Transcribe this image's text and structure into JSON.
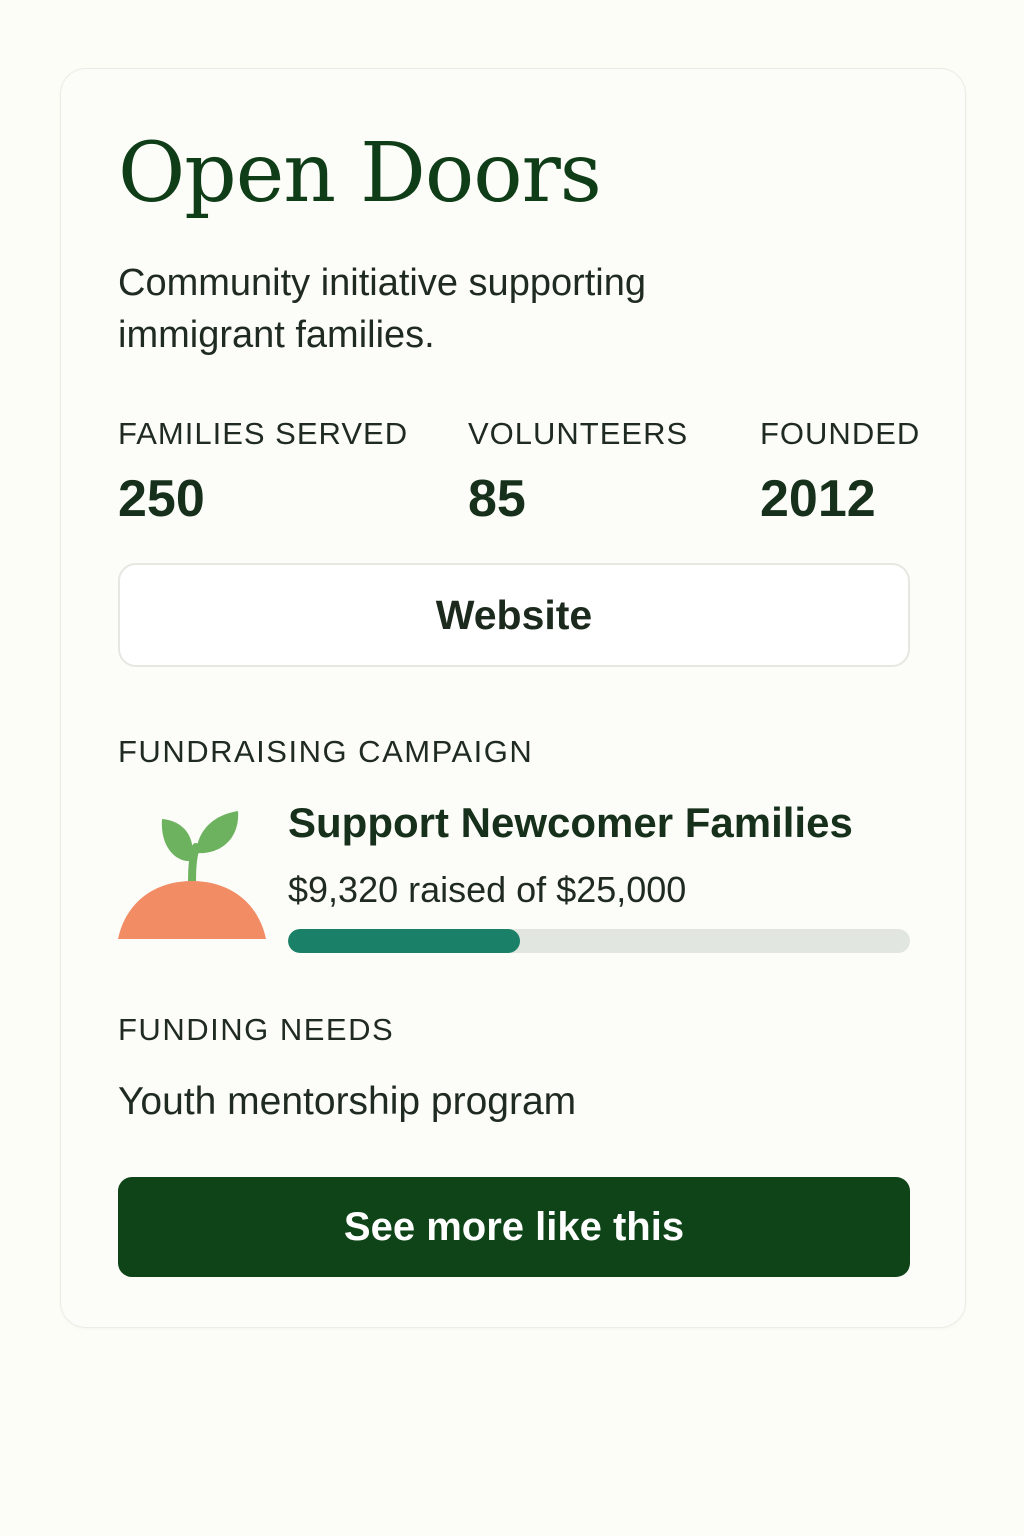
{
  "org": {
    "name": "Open Doors",
    "description": "Community initiative supporting immigrant families."
  },
  "stats": [
    {
      "label": "FAMILIES SERVED",
      "value": "250"
    },
    {
      "label": "VOLUNTEERS",
      "value": "85"
    },
    {
      "label": "FOUNDED",
      "value": "2012"
    }
  ],
  "website_button": {
    "label": "Website"
  },
  "campaign": {
    "section_label": "FUNDRAISING CAMPAIGN",
    "icon": "sprout-icon",
    "title": "Support Newcomer Families",
    "raised_text": "$9,320 raised of $25,000",
    "raised": 9320,
    "goal": 25000,
    "progress_percent": 37.3
  },
  "funding_needs": {
    "section_label": "FUNDING NEEDS",
    "text": "Youth mentorship program"
  },
  "primary_button": {
    "label": "See more like this"
  },
  "colors": {
    "brand_green": "#0e4417",
    "title_green": "#0f3d17",
    "progress_fill": "#1b8068",
    "progress_track": "#e2e6e0",
    "sprout_leaf": "#6db25f",
    "sprout_soil": "#f28c64",
    "page_background": "#fdfdf7"
  }
}
